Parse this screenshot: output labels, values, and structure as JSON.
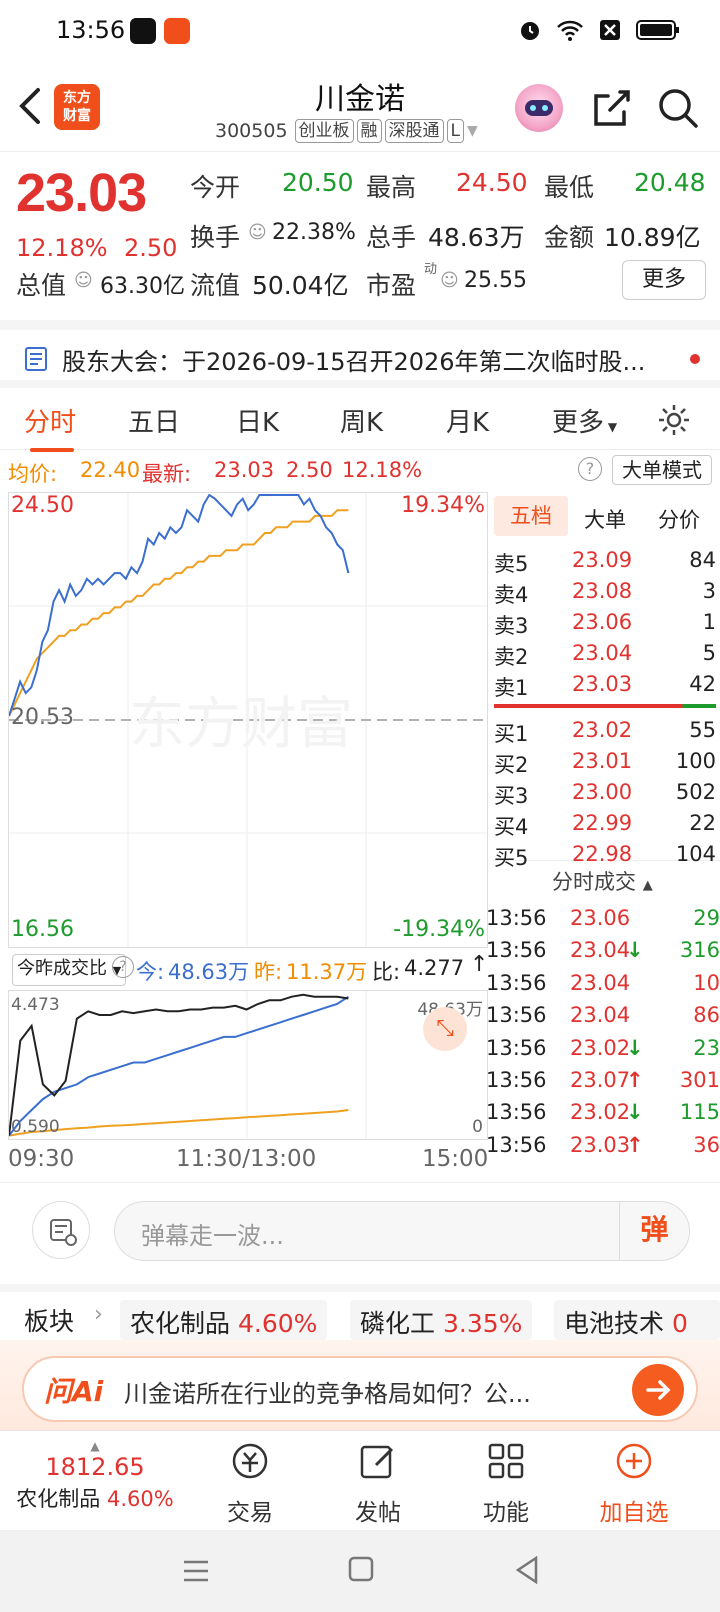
{
  "status_bar": {
    "time": "13:56"
  },
  "header": {
    "logo_line1": "东方",
    "logo_line2": "财富",
    "name": "川金诺",
    "code": "300505",
    "tags": [
      "创业板",
      "融",
      "深股通",
      "L"
    ]
  },
  "quote": {
    "price": "23.03",
    "pct": "12.18%",
    "change": "2.50",
    "open_label": "今开",
    "open": "20.50",
    "high_label": "最高",
    "high": "24.50",
    "low_label": "最低",
    "low": "20.48",
    "turnover_label": "换手",
    "turnover": "22.38%",
    "volume_label": "总手",
    "volume": "48.63万",
    "amount_label": "金额",
    "amount": "10.89亿",
    "mcap_label": "总值",
    "mcap": "63.30亿",
    "float_label": "流值",
    "float": "50.04亿",
    "pe_label": "市盈",
    "pe_sup": "动",
    "pe": "25.55",
    "more": "更多"
  },
  "notice": {
    "text": "股东大会：于2026-09-15召开2026年第二次临时股..."
  },
  "tabs": [
    "分时",
    "五日",
    "日K",
    "周K",
    "月K",
    "更多"
  ],
  "info_row": {
    "avg_label": "均价:",
    "avg": "22.40",
    "latest_label": "最新:",
    "latest": "23.03",
    "latest_chg": "2.50",
    "latest_pct": "12.18%",
    "big_mode": "大单模式"
  },
  "chart_data": {
    "type": "line",
    "y_labels": {
      "top": "24.50",
      "mid": "20.53",
      "bottom": "16.56",
      "top_pct": "19.34%",
      "bottom_pct": "-19.34%"
    },
    "ylim": [
      16.56,
      24.5
    ],
    "series": [
      {
        "color": "#3a6fd0",
        "values": [
          20.6,
          20.9,
          21.2,
          21.0,
          21.1,
          21.4,
          21.9,
          22.1,
          22.6,
          22.8,
          22.6,
          22.9,
          22.7,
          22.8,
          23.0,
          22.9,
          23.0,
          22.9,
          23.0,
          23.1,
          23.1,
          23.0,
          23.2,
          23.1,
          23.3,
          23.7,
          23.6,
          23.8,
          23.7,
          23.9,
          23.8,
          23.9,
          24.2,
          24.1,
          24.0,
          24.3,
          24.5,
          24.4,
          24.3,
          24.2,
          24.1,
          24.3,
          24.4,
          24.2,
          24.3,
          24.5,
          25.9,
          24.9,
          24.6,
          24.8,
          24.5,
          24.7,
          24.5,
          24.3,
          24.4,
          24.2,
          24.1,
          23.9,
          23.8,
          23.6,
          23.5,
          23.1
        ]
      },
      {
        "color": "#f0a020",
        "values": [
          20.6,
          20.8,
          21.0,
          21.2,
          21.4,
          21.6,
          21.7,
          21.8,
          21.9,
          22.0,
          22.0,
          22.1,
          22.1,
          22.2,
          22.2,
          22.3,
          22.3,
          22.4,
          22.4,
          22.5,
          22.5,
          22.6,
          22.6,
          22.7,
          22.7,
          22.8,
          22.9,
          22.9,
          23.0,
          23.0,
          23.1,
          23.1,
          23.2,
          23.2,
          23.3,
          23.3,
          23.4,
          23.4,
          23.4,
          23.5,
          23.5,
          23.5,
          23.6,
          23.6,
          23.6,
          23.7,
          23.8,
          23.8,
          23.9,
          23.9,
          23.9,
          24.0,
          24.0,
          24.0,
          24.0,
          24.1,
          24.1,
          24.1,
          24.1,
          24.2,
          24.2,
          24.2
        ]
      }
    ]
  },
  "vol_compare": {
    "selector": "今昨成交比",
    "today_label": "今:",
    "today": "48.63万",
    "yest_label": "昨:",
    "yest": "11.37万",
    "ratio_label": "比:",
    "ratio": "4.277",
    "y_top": "4.473",
    "y_bottom": "0.590",
    "right_top": "48.63万",
    "right_bottom": "0",
    "x_labels": [
      "09:30",
      "11:30/13:00",
      "15:00"
    ],
    "ratio_series": [
      0.6,
      3.2,
      3.6,
      2.0,
      1.7,
      2.1,
      3.8,
      4.0,
      3.9,
      3.9,
      4.0,
      3.95,
      4.0,
      4.05,
      4.0,
      4.0,
      4.05,
      4.05,
      4.1,
      4.1,
      4.15,
      4.05,
      4.2,
      4.3,
      4.3,
      4.4,
      4.45,
      4.4,
      4.4,
      4.4,
      4.35
    ],
    "today_series": [
      0.6,
      1.0,
      1.3,
      1.6,
      1.8,
      1.9,
      2.0,
      2.2,
      2.3,
      2.4,
      2.5,
      2.6,
      2.6,
      2.7,
      2.8,
      2.9,
      3.0,
      3.1,
      3.2,
      3.3,
      3.3,
      3.4,
      3.5,
      3.6,
      3.7,
      3.8,
      3.9,
      4.0,
      4.1,
      4.2,
      4.4
    ],
    "yest_series": [
      0.6,
      0.65,
      0.7,
      0.72,
      0.75,
      0.78,
      0.8,
      0.82,
      0.85,
      0.87,
      0.88,
      0.9,
      0.92,
      0.94,
      0.96,
      0.98,
      1.0,
      1.02,
      1.04,
      1.06,
      1.08,
      1.1,
      1.12,
      1.14,
      1.16,
      1.18,
      1.2,
      1.22,
      1.24,
      1.26,
      1.3
    ]
  },
  "order_book": {
    "tabs": [
      "五档",
      "大单",
      "分价"
    ],
    "asks": [
      {
        "label": "卖5",
        "price": "23.09",
        "qty": "84"
      },
      {
        "label": "卖4",
        "price": "23.08",
        "qty": "3"
      },
      {
        "label": "卖3",
        "price": "23.06",
        "qty": "1"
      },
      {
        "label": "卖2",
        "price": "23.04",
        "qty": "5"
      },
      {
        "label": "卖1",
        "price": "23.03",
        "qty": "42"
      }
    ],
    "bids": [
      {
        "label": "买1",
        "price": "23.02",
        "qty": "55"
      },
      {
        "label": "买2",
        "price": "23.01",
        "qty": "100"
      },
      {
        "label": "买3",
        "price": "23.00",
        "qty": "502"
      },
      {
        "label": "买4",
        "price": "22.99",
        "qty": "22"
      },
      {
        "label": "买5",
        "price": "22.98",
        "qty": "104"
      }
    ],
    "ticks_title": "分时成交",
    "ticks": [
      {
        "time": "13:56",
        "price": "23.06",
        "arrow": "",
        "qty": "29",
        "qcolor": "green"
      },
      {
        "time": "13:56",
        "price": "23.04",
        "arrow": "↓",
        "qty": "316",
        "qcolor": "green"
      },
      {
        "time": "13:56",
        "price": "23.04",
        "arrow": "",
        "qty": "10",
        "qcolor": "red"
      },
      {
        "time": "13:56",
        "price": "23.04",
        "arrow": "",
        "qty": "86",
        "qcolor": "red"
      },
      {
        "time": "13:56",
        "price": "23.02",
        "arrow": "↓",
        "qty": "23",
        "qcolor": "green"
      },
      {
        "time": "13:56",
        "price": "23.07",
        "arrow": "↑",
        "qty": "301",
        "qcolor": "red"
      },
      {
        "time": "13:56",
        "price": "23.02",
        "arrow": "↓",
        "qty": "115",
        "qcolor": "green"
      },
      {
        "time": "13:56",
        "price": "23.03",
        "arrow": "↑",
        "qty": "36",
        "qcolor": "red"
      }
    ]
  },
  "comment": {
    "placeholder": "弹幕走一波...",
    "send": "弹"
  },
  "sectors": {
    "label": "板块",
    "items": [
      {
        "name": "农化制品",
        "pct": "4.60%"
      },
      {
        "name": "磷化工",
        "pct": "3.35%"
      },
      {
        "name": "电池技术",
        "pct": "0"
      }
    ]
  },
  "ai": {
    "logo": "问Ai",
    "question": "川金诺所在行业的竞争格局如何？公..."
  },
  "bottom_nav": {
    "index_value": "1812.65",
    "index_name": "农化制品",
    "index_pct": "4.60%",
    "items": [
      "交易",
      "发帖",
      "功能",
      "加自选"
    ]
  }
}
